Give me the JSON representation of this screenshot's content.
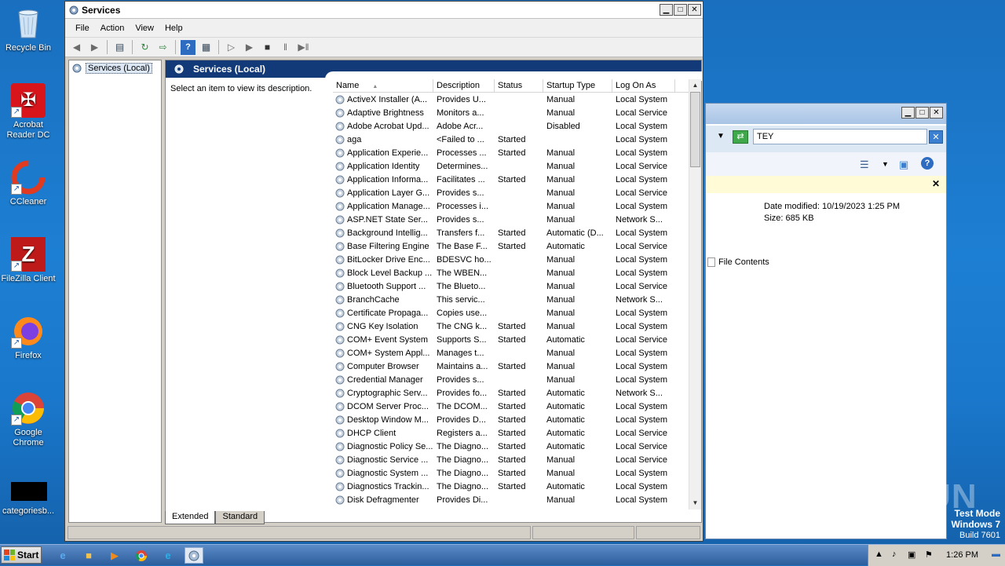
{
  "desktop": {
    "icons": [
      {
        "label": "Recycle Bin"
      },
      {
        "label": "Acrobat Reader DC"
      },
      {
        "label": "CCleaner"
      },
      {
        "label": "FileZilla Client"
      },
      {
        "label": "Firefox"
      },
      {
        "label": "Google Chrome"
      },
      {
        "label": "categoriesb..."
      }
    ],
    "watermark": "ANY RUN",
    "testmode": {
      "line1": "Test Mode",
      "line2": "Windows 7",
      "line3": "Build 7601"
    }
  },
  "explorer": {
    "search_value": "TEY",
    "date_modified": "Date modified: 10/19/2023 1:25 PM",
    "size": "Size: 685 KB",
    "file_contents": "File Contents"
  },
  "services_window": {
    "title": "Services",
    "menu": [
      "File",
      "Action",
      "View",
      "Help"
    ],
    "tree_node": "Services (Local)",
    "header": "Services (Local)",
    "description_prompt": "Select an item to view its description.",
    "columns": [
      "Name",
      "Description",
      "Status",
      "Startup Type",
      "Log On As"
    ],
    "rows": [
      [
        "ActiveX Installer (A...",
        "Provides U...",
        "",
        "Manual",
        "Local System"
      ],
      [
        "Adaptive Brightness",
        "Monitors a...",
        "",
        "Manual",
        "Local Service"
      ],
      [
        "Adobe Acrobat Upd...",
        "Adobe Acr...",
        "",
        "Disabled",
        "Local System"
      ],
      [
        "aga",
        "<Failed to ...",
        "Started",
        "",
        "Local System"
      ],
      [
        "Application Experie...",
        "Processes ...",
        "Started",
        "Manual",
        "Local System"
      ],
      [
        "Application Identity",
        "Determines...",
        "",
        "Manual",
        "Local Service"
      ],
      [
        "Application Informa...",
        "Facilitates ...",
        "Started",
        "Manual",
        "Local System"
      ],
      [
        "Application Layer G...",
        "Provides s...",
        "",
        "Manual",
        "Local Service"
      ],
      [
        "Application Manage...",
        "Processes i...",
        "",
        "Manual",
        "Local System"
      ],
      [
        "ASP.NET State Ser...",
        "Provides s...",
        "",
        "Manual",
        "Network S..."
      ],
      [
        "Background Intellig...",
        "Transfers f...",
        "Started",
        "Automatic (D...",
        "Local System"
      ],
      [
        "Base Filtering Engine",
        "The Base F...",
        "Started",
        "Automatic",
        "Local Service"
      ],
      [
        "BitLocker Drive Enc...",
        "BDESVC ho...",
        "",
        "Manual",
        "Local System"
      ],
      [
        "Block Level Backup ...",
        "The WBEN...",
        "",
        "Manual",
        "Local System"
      ],
      [
        "Bluetooth Support ...",
        "The Blueto...",
        "",
        "Manual",
        "Local Service"
      ],
      [
        "BranchCache",
        "This servic...",
        "",
        "Manual",
        "Network S..."
      ],
      [
        "Certificate Propaga...",
        "Copies use...",
        "",
        "Manual",
        "Local System"
      ],
      [
        "CNG Key Isolation",
        "The CNG k...",
        "Started",
        "Manual",
        "Local System"
      ],
      [
        "COM+ Event System",
        "Supports S...",
        "Started",
        "Automatic",
        "Local Service"
      ],
      [
        "COM+ System Appl...",
        "Manages t...",
        "",
        "Manual",
        "Local System"
      ],
      [
        "Computer Browser",
        "Maintains a...",
        "Started",
        "Manual",
        "Local System"
      ],
      [
        "Credential Manager",
        "Provides s...",
        "",
        "Manual",
        "Local System"
      ],
      [
        "Cryptographic Serv...",
        "Provides fo...",
        "Started",
        "Automatic",
        "Network S..."
      ],
      [
        "DCOM Server Proc...",
        "The DCOM...",
        "Started",
        "Automatic",
        "Local System"
      ],
      [
        "Desktop Window M...",
        "Provides D...",
        "Started",
        "Automatic",
        "Local System"
      ],
      [
        "DHCP Client",
        "Registers a...",
        "Started",
        "Automatic",
        "Local Service"
      ],
      [
        "Diagnostic Policy Se...",
        "The Diagno...",
        "Started",
        "Automatic",
        "Local Service"
      ],
      [
        "Diagnostic Service ...",
        "The Diagno...",
        "Started",
        "Manual",
        "Local Service"
      ],
      [
        "Diagnostic System ...",
        "The Diagno...",
        "Started",
        "Manual",
        "Local System"
      ],
      [
        "Diagnostics Trackin...",
        "The Diagno...",
        "Started",
        "Automatic",
        "Local System"
      ],
      [
        "Disk Defragmenter",
        "Provides Di...",
        "",
        "Manual",
        "Local System"
      ]
    ],
    "tabs": [
      "Extended",
      "Standard"
    ]
  },
  "taskbar": {
    "start_label": "Start",
    "clock": "1:26 PM"
  }
}
